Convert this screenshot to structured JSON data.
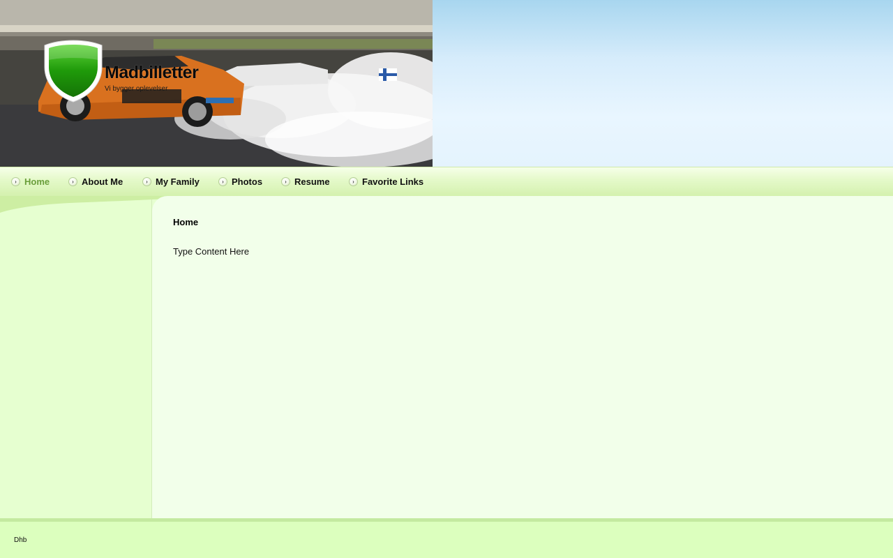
{
  "site": {
    "title": "Madbilletter",
    "tagline": "Vi bygger oplevelser"
  },
  "header": {
    "shield_icon": "shield-icon",
    "photo": "drift-car-photo"
  },
  "nav": {
    "items": [
      {
        "label": "Home",
        "active": true
      },
      {
        "label": "About Me",
        "active": false
      },
      {
        "label": "My Family",
        "active": false
      },
      {
        "label": "Photos",
        "active": false
      },
      {
        "label": "Resume",
        "active": false
      },
      {
        "label": "Favorite Links",
        "active": false
      }
    ],
    "bullet_icon": "arrow-circle-icon"
  },
  "content": {
    "heading": "Home",
    "body": "Type Content Here"
  },
  "footer": {
    "text": "Dhb"
  },
  "colors": {
    "accent": "#6a9e3a",
    "content_bg": "#f2ffea",
    "sidebar_bg": "#e6ffd0",
    "footer_bg": "#dcffbe",
    "shield_green": "#1f9a0a"
  }
}
